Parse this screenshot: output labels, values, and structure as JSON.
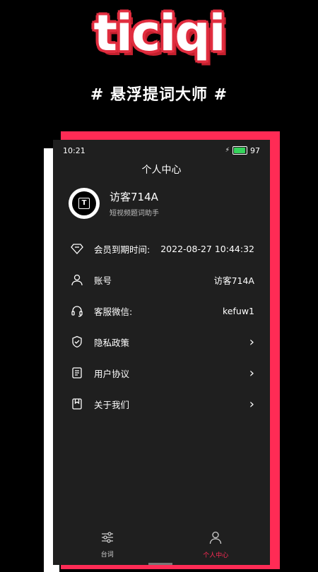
{
  "promo": {
    "logo": "ticiqi",
    "tagline": "# 悬浮提词大师 #"
  },
  "colors": {
    "accent": "#ff2b55",
    "screen_bg": "#1f1f1f",
    "battery": "#35d35b"
  },
  "status_bar": {
    "time": "10:21",
    "battery": "97"
  },
  "header": {
    "title": "个人中心"
  },
  "profile": {
    "name": "访客714A",
    "subtitle": "短视频题词助手",
    "avatar_letter": "T"
  },
  "menu": [
    {
      "icon": "diamond-icon",
      "label": "会员到期时间:",
      "value": "2022-08-27 10:44:32"
    },
    {
      "icon": "user-icon",
      "label": "账号",
      "value": "访客714A"
    },
    {
      "icon": "headset-icon",
      "label": "客服微信:",
      "value": "kefuw1"
    },
    {
      "icon": "shield-check-icon",
      "label": "隐私政策",
      "value": ""
    },
    {
      "icon": "document-icon",
      "label": "用户协议",
      "value": ""
    },
    {
      "icon": "bookmark-icon",
      "label": "关于我们",
      "value": ""
    }
  ],
  "tabs": [
    {
      "icon": "sliders-icon",
      "label": "台词",
      "active": false
    },
    {
      "icon": "person-icon",
      "label": "个人中心",
      "active": true
    }
  ]
}
